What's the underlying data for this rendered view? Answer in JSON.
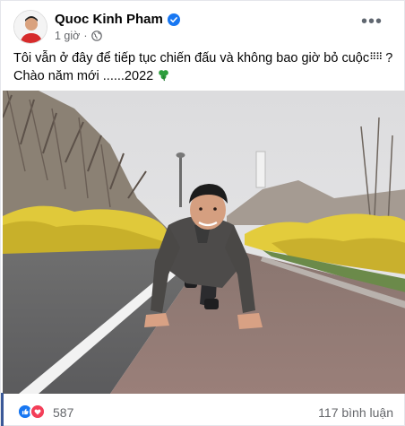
{
  "post": {
    "author": "Quoc Kinh Pham",
    "time": "1 giờ",
    "dot": "·",
    "more": "•••",
    "line1": "Tôi vẫn ở đây để tiếp tục chiến đấu và không bao giờ bỏ cuộc",
    "line1_end": "?",
    "emoji_dots": "⠿⠿",
    "line2": "Chào năm mới ......2022"
  },
  "footer": {
    "reaction_count": "587",
    "comments": "117 bình luận"
  },
  "colors": {
    "like": "#1877f2",
    "love": "#f33e58",
    "verified": "#1877f2",
    "clover": "#2e9e3e"
  },
  "icons": [
    "verified-badge-icon",
    "globe-icon",
    "more-options-icon",
    "clover-emoji-icon",
    "like-reaction-icon",
    "love-reaction-icon"
  ]
}
